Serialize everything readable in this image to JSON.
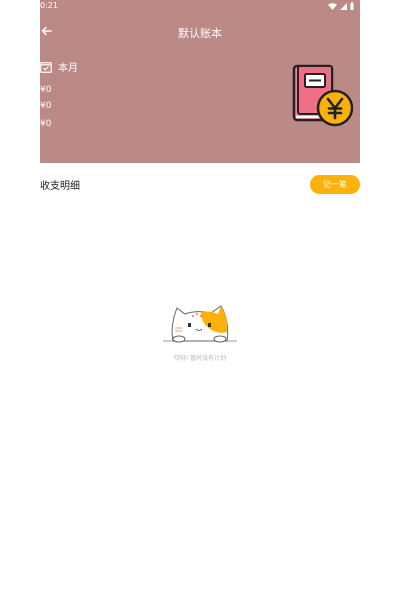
{
  "status_bar": {
    "time": "0:21"
  },
  "nav": {
    "title": "默认账本"
  },
  "summary": {
    "period_label": "本月",
    "amounts": [
      "¥0",
      "¥0",
      "¥0"
    ]
  },
  "details": {
    "section_title": "收支明细",
    "add_button_label": "记一笔"
  },
  "empty_state": {
    "message": "哎呀! 暂时没有计划"
  },
  "colors": {
    "header_bg": "#bc8a86",
    "accent": "#fbb10a",
    "book_pink": "#f0879a"
  },
  "icons": [
    "back-arrow-icon",
    "calendar-check-icon",
    "wifi-icon",
    "signal-icon",
    "battery-icon",
    "account-book-yen-icon",
    "empty-cat-illustration"
  ]
}
